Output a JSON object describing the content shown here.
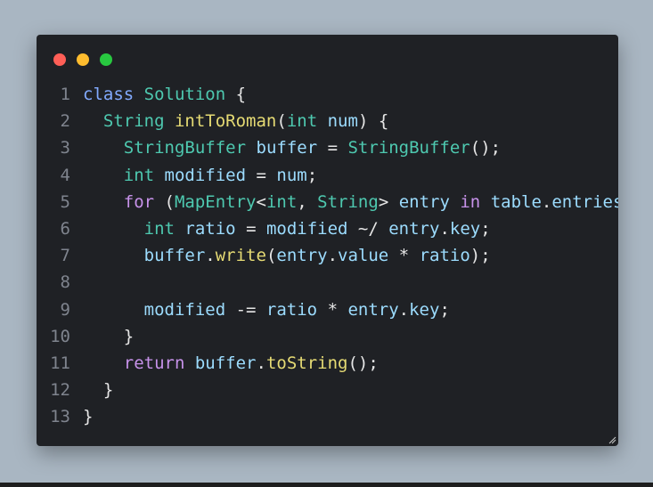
{
  "window": {
    "controls": {
      "close": "close",
      "minimize": "minimize",
      "maximize": "maximize"
    }
  },
  "code": {
    "lines": [
      {
        "n": "1",
        "t": [
          [
            "kw",
            "class"
          ],
          [
            "punc",
            " "
          ],
          [
            "type",
            "Solution"
          ],
          [
            "punc",
            " {"
          ]
        ]
      },
      {
        "n": "2",
        "t": [
          [
            "punc",
            "  "
          ],
          [
            "type",
            "String"
          ],
          [
            "punc",
            " "
          ],
          [
            "fn",
            "intToRoman"
          ],
          [
            "punc",
            "("
          ],
          [
            "type",
            "int"
          ],
          [
            "punc",
            " "
          ],
          [
            "var",
            "num"
          ],
          [
            "punc",
            ") {"
          ]
        ]
      },
      {
        "n": "3",
        "t": [
          [
            "punc",
            "    "
          ],
          [
            "type",
            "StringBuffer"
          ],
          [
            "punc",
            " "
          ],
          [
            "var",
            "buffer"
          ],
          [
            "op",
            " = "
          ],
          [
            "type",
            "StringBuffer"
          ],
          [
            "punc",
            "();"
          ]
        ]
      },
      {
        "n": "4",
        "t": [
          [
            "punc",
            "    "
          ],
          [
            "type",
            "int"
          ],
          [
            "punc",
            " "
          ],
          [
            "var",
            "modified"
          ],
          [
            "op",
            " = "
          ],
          [
            "var",
            "num"
          ],
          [
            "punc",
            ";"
          ]
        ]
      },
      {
        "n": "5",
        "t": [
          [
            "punc",
            "    "
          ],
          [
            "kw2",
            "for"
          ],
          [
            "punc",
            " ("
          ],
          [
            "type",
            "MapEntry"
          ],
          [
            "punc",
            "<"
          ],
          [
            "type",
            "int"
          ],
          [
            "punc",
            ", "
          ],
          [
            "type",
            "String"
          ],
          [
            "punc",
            "> "
          ],
          [
            "var",
            "entry"
          ],
          [
            "punc",
            " "
          ],
          [
            "kw2",
            "in"
          ],
          [
            "punc",
            " "
          ],
          [
            "var",
            "table"
          ],
          [
            "punc",
            "."
          ],
          [
            "prop",
            "entries"
          ],
          [
            "punc",
            ") {"
          ]
        ]
      },
      {
        "n": "6",
        "t": [
          [
            "punc",
            "      "
          ],
          [
            "type",
            "int"
          ],
          [
            "punc",
            " "
          ],
          [
            "var",
            "ratio"
          ],
          [
            "op",
            " = "
          ],
          [
            "var",
            "modified"
          ],
          [
            "op",
            " ~/ "
          ],
          [
            "var",
            "entry"
          ],
          [
            "punc",
            "."
          ],
          [
            "prop",
            "key"
          ],
          [
            "punc",
            ";"
          ]
        ]
      },
      {
        "n": "7",
        "t": [
          [
            "punc",
            "      "
          ],
          [
            "var",
            "buffer"
          ],
          [
            "punc",
            "."
          ],
          [
            "fn",
            "write"
          ],
          [
            "punc",
            "("
          ],
          [
            "var",
            "entry"
          ],
          [
            "punc",
            "."
          ],
          [
            "prop",
            "value"
          ],
          [
            "op",
            " * "
          ],
          [
            "var",
            "ratio"
          ],
          [
            "punc",
            ");"
          ]
        ]
      },
      {
        "n": "8",
        "t": [
          [
            "punc",
            " "
          ]
        ]
      },
      {
        "n": "9",
        "t": [
          [
            "punc",
            "      "
          ],
          [
            "var",
            "modified"
          ],
          [
            "op",
            " -= "
          ],
          [
            "var",
            "ratio"
          ],
          [
            "op",
            " * "
          ],
          [
            "var",
            "entry"
          ],
          [
            "punc",
            "."
          ],
          [
            "prop",
            "key"
          ],
          [
            "punc",
            ";"
          ]
        ]
      },
      {
        "n": "10",
        "t": [
          [
            "punc",
            "    }"
          ]
        ]
      },
      {
        "n": "11",
        "t": [
          [
            "punc",
            "    "
          ],
          [
            "kw2",
            "return"
          ],
          [
            "punc",
            " "
          ],
          [
            "var",
            "buffer"
          ],
          [
            "punc",
            "."
          ],
          [
            "fn",
            "toString"
          ],
          [
            "punc",
            "();"
          ]
        ]
      },
      {
        "n": "12",
        "t": [
          [
            "punc",
            "  }"
          ]
        ]
      },
      {
        "n": "13",
        "t": [
          [
            "punc",
            "}"
          ]
        ]
      }
    ]
  }
}
